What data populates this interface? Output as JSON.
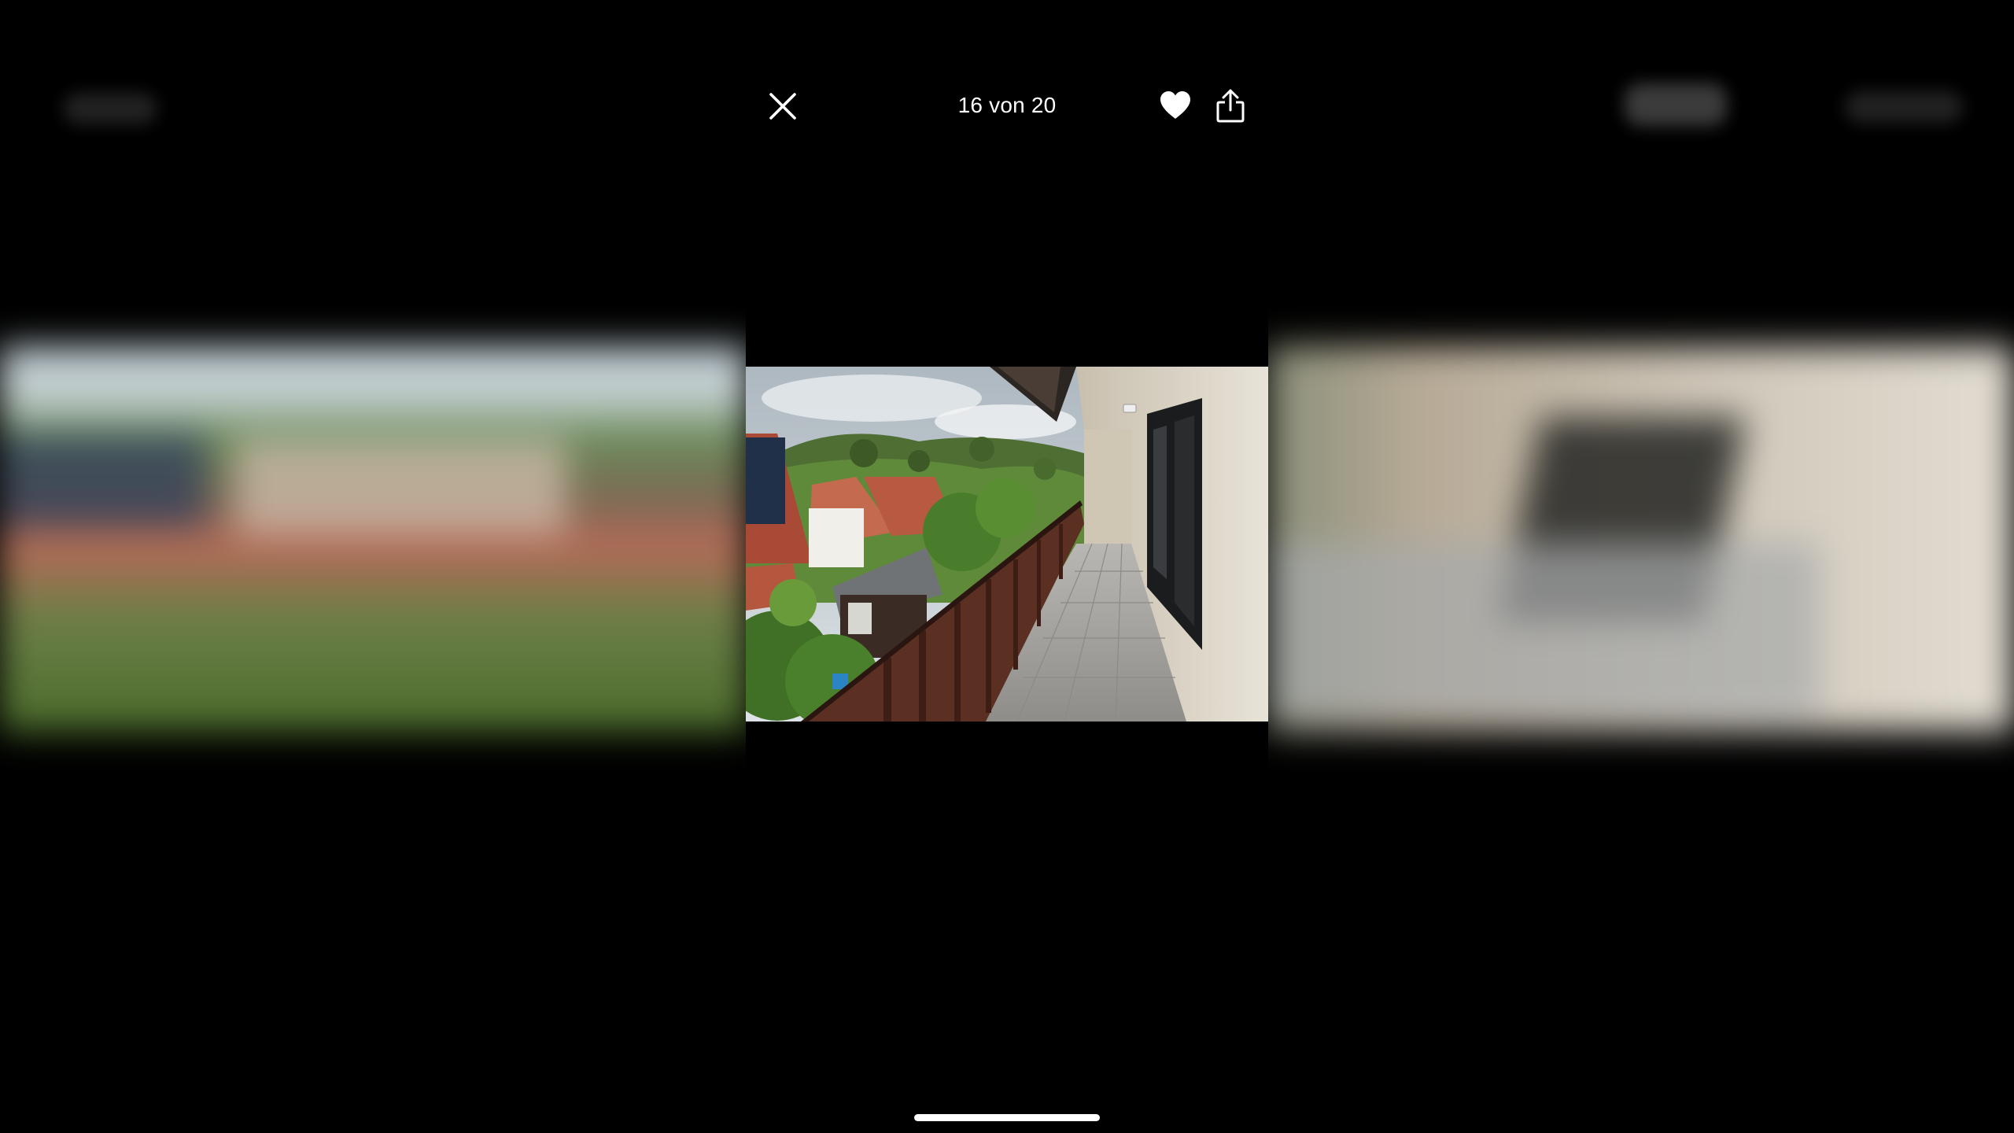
{
  "viewer": {
    "counter": "16 von 20",
    "current_index": 16,
    "total_count": 20,
    "is_favorite": true
  },
  "icons": {
    "close": "close-icon",
    "favorite": "heart-icon",
    "share": "share-icon"
  },
  "photo": {
    "subject": "balcony-view-photo"
  },
  "colors": {
    "background": "#000000",
    "foreground": "#ffffff"
  }
}
